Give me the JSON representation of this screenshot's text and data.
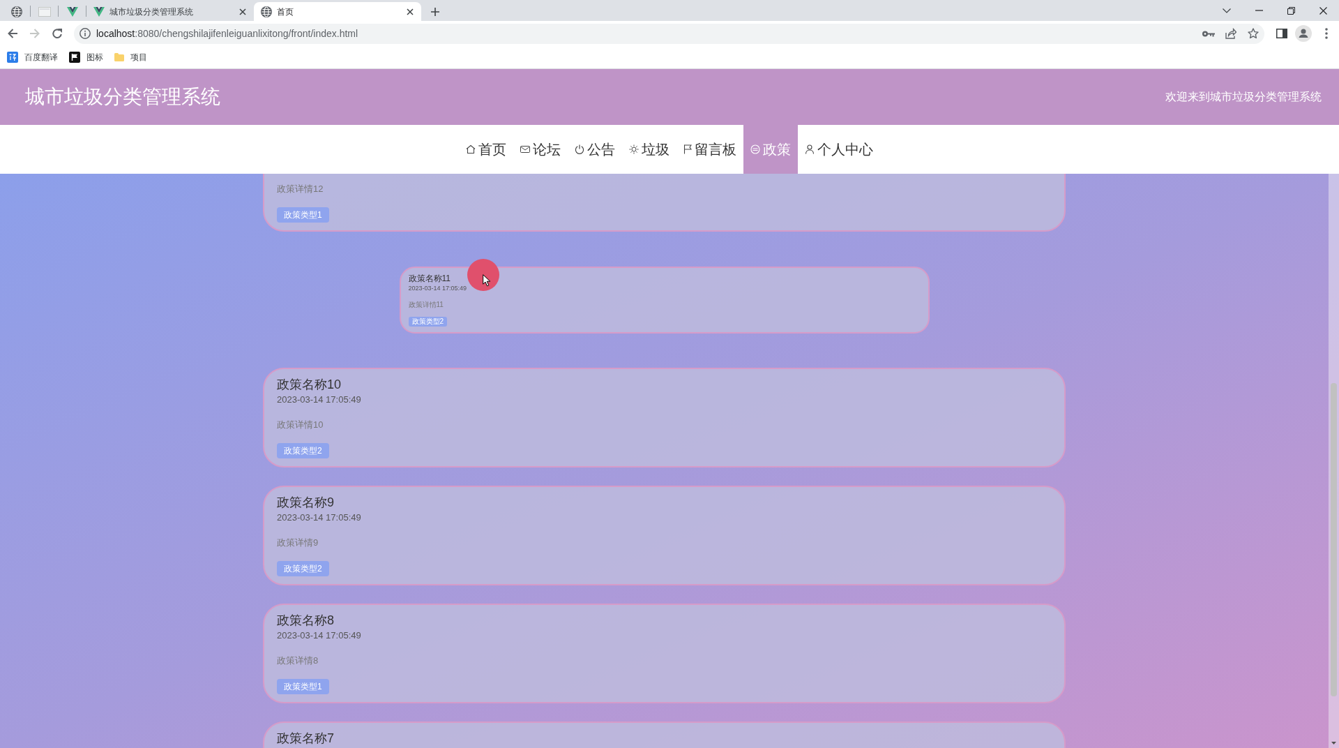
{
  "browser": {
    "tabs": [
      {
        "kind": "pinned",
        "selected": false
      },
      {
        "kind": "pinned",
        "selected": false
      },
      {
        "kind": "pinned",
        "selected": false
      },
      {
        "kind": "page",
        "title": "城市垃圾分类管理系统",
        "selected": false
      },
      {
        "kind": "page",
        "title": "首页",
        "selected": true
      }
    ],
    "address_bar": {
      "host": "localhost",
      "path": ":8080/chengshilajifenleiguanlixitong/front/index.html"
    },
    "bookmarks": [
      {
        "label": "百度翻译"
      },
      {
        "label": "图标"
      },
      {
        "label": "项目"
      }
    ]
  },
  "header": {
    "title": "城市垃圾分类管理系统",
    "welcome": "欢迎来到城市垃圾分类管理系统"
  },
  "nav": [
    {
      "label": "首页",
      "selected": false
    },
    {
      "label": "论坛",
      "selected": false
    },
    {
      "label": "公告",
      "selected": false
    },
    {
      "label": "垃圾",
      "selected": false
    },
    {
      "label": "留言板",
      "selected": false
    },
    {
      "label": "政策",
      "selected": true
    },
    {
      "label": "个人中心",
      "selected": false
    }
  ],
  "policies": [
    {
      "kind": "card",
      "detail": "政策详情12",
      "tag": "政策类型1"
    },
    {
      "kind": "shrunk",
      "title": "政策名称11",
      "date": "2023-03-14 17:05:49",
      "detail": "政策详情11",
      "tag": "政策类型2"
    },
    {
      "kind": "card",
      "title": "政策名称10",
      "date": "2023-03-14 17:05:49",
      "detail": "政策详情10",
      "tag": "政策类型2"
    },
    {
      "kind": "card",
      "title": "政策名称9",
      "date": "2023-03-14 17:05:49",
      "detail": "政策详情9",
      "tag": "政策类型2"
    },
    {
      "kind": "card",
      "title": "政策名称8",
      "date": "2023-03-14 17:05:49",
      "detail": "政策详情8",
      "tag": "政策类型1"
    },
    {
      "kind": "card",
      "title": "政策名称7"
    }
  ]
}
